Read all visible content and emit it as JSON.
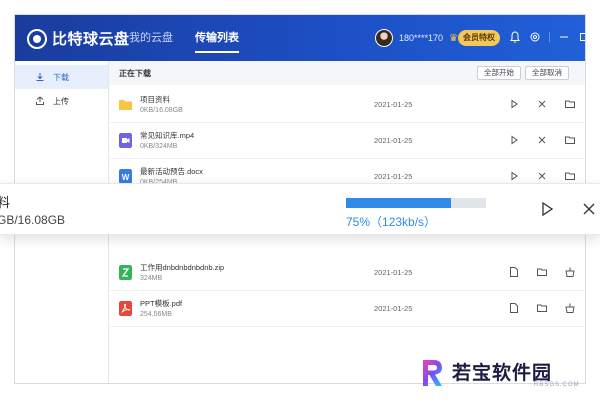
{
  "app": {
    "logo_text": "比特球云盘",
    "nav": [
      {
        "label": "我的云盘",
        "active": false
      },
      {
        "label": "传输列表",
        "active": true
      }
    ],
    "user": {
      "name": "180****170"
    },
    "vip_label": "会员特权",
    "window_icons": [
      "bell-icon",
      "settings-icon",
      "minimize-icon",
      "maximize-icon",
      "close-icon"
    ]
  },
  "sidebar": {
    "items": [
      {
        "label": "下载",
        "icon": "download-icon",
        "active": true
      },
      {
        "label": "上传",
        "icon": "upload-icon",
        "active": false
      }
    ]
  },
  "main": {
    "section_title": "正在下载",
    "start_all_label": "全部开始",
    "cancel_all_label": "全部取消"
  },
  "downloading": [
    {
      "name": "项目资料",
      "size": "0KB/16.08GB",
      "date": "2021-01-25",
      "type": "folder",
      "color": "#f7c544"
    },
    {
      "name": "常见知识库.mp4",
      "size": "0KB/324MB",
      "date": "2021-01-25",
      "type": "video",
      "color": "#6f63e8"
    },
    {
      "name": "最新活动预告.docx",
      "size": "0KB/254MB",
      "date": "2021-01-25",
      "type": "word",
      "color": "#3a7ae6"
    }
  ],
  "completed": [
    {
      "name": "工作用dnbdnbdnbdnb.zip",
      "size": "324MB",
      "date": "2021-01-25",
      "type": "zip",
      "color": "#34b35a"
    },
    {
      "name": "PPT模板.pdf",
      "size": "254.56MB",
      "date": "2021-01-25",
      "type": "pdf",
      "color": "#e8483b"
    }
  ],
  "floating_item": {
    "name": "料",
    "size": "GB/16.08GB",
    "progress_text": "75%（123kb/s）",
    "progress": 0.75
  },
  "watermark": {
    "text": "若宝软件园",
    "sub": "RBSGS.COM"
  },
  "colors": {
    "accent": "#2b62d8",
    "progress": "#2f8be8",
    "titlebar": "#1d4fc4"
  }
}
